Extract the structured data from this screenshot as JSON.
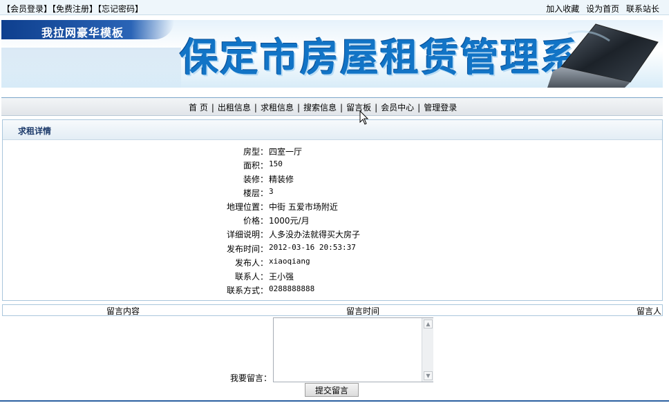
{
  "topbar": {
    "left_links": [
      "【会员登录】",
      "【免费注册】",
      "【忘记密码】"
    ],
    "right_links": [
      "加入收藏",
      "设为首页",
      "联系站长"
    ]
  },
  "banner": {
    "tab_label": "我拉网豪华模板",
    "title": "保定市房屋租赁管理系统"
  },
  "nav": {
    "items": [
      "首 页",
      "出租信息",
      "求租信息",
      "搜索信息",
      "留言板",
      "会员中心",
      "管理登录"
    ]
  },
  "detail": {
    "heading": "求租详情",
    "rows": [
      {
        "label": "房型：",
        "value": "四室一厅"
      },
      {
        "label": "面积：",
        "value": "150"
      },
      {
        "label": "装修：",
        "value": "精装修"
      },
      {
        "label": "楼层：",
        "value": "3"
      },
      {
        "label": "地理位置：",
        "value": "中街 五爱市场附近"
      },
      {
        "label": "价格：",
        "value": "1000元/月"
      },
      {
        "label": "详细说明：",
        "value": "人多没办法就得买大房子"
      },
      {
        "label": "发布时间：",
        "value": "2012-03-16 20:53:37"
      },
      {
        "label": "发布人：",
        "value": "xiaoqiang"
      },
      {
        "label": "联系人：",
        "value": "王小强"
      },
      {
        "label": "联系方式：",
        "value": "0288888888"
      }
    ]
  },
  "comments": {
    "col_content": "留言内容",
    "col_time": "留言时间",
    "col_author": "留言人"
  },
  "message_form": {
    "label": "我要留言：",
    "text_value": "",
    "submit_label": "提交留言"
  },
  "colors": {
    "title_blue": "#1274c6",
    "nav_border": "#7aa5c9",
    "panel_border": "#a9c6dc",
    "heading_text": "#1d3b6b"
  }
}
